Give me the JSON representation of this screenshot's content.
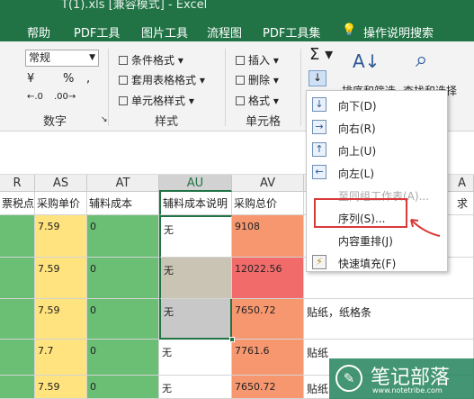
{
  "app": {
    "title": "T(1).xls [兼容模式] - Excel",
    "accent": "#217346"
  },
  "menubar": {
    "items": [
      "帮助",
      "PDF工具",
      "图片工具",
      "流程图",
      "PDF工具集",
      "操作说明搜索"
    ]
  },
  "ribbon": {
    "number_format": "常规",
    "currency_symbol": "¥",
    "percent_symbol": "%",
    "comma_symbol": ",",
    "styles_items": [
      "条件格式",
      "套用表格格式",
      "单元格样式"
    ],
    "cells_items": [
      "插入",
      "删除",
      "格式"
    ],
    "sort_filter": "排序和筛选",
    "find_select": "查找和选择",
    "groups": [
      "数字",
      "样式",
      "单元格"
    ]
  },
  "columns": [
    {
      "letter": "R",
      "header": "票税点"
    },
    {
      "letter": "AS",
      "header": "采购单价"
    },
    {
      "letter": "AT",
      "header": "辅料成本"
    },
    {
      "letter": "AU",
      "header": "辅料成本说明"
    },
    {
      "letter": "AV",
      "header": "采购总价"
    },
    {
      "letter": "A",
      "header": "求"
    }
  ],
  "rows": [
    {
      "as": "7.59",
      "at": "0",
      "au": "无",
      "av": "9108",
      "aw": ""
    },
    {
      "as": "7.59",
      "at": "0",
      "au": "无",
      "av": "12022.56",
      "aw": ""
    },
    {
      "as": "7.59",
      "at": "0",
      "au": "无",
      "av": "7650.72",
      "aw": "贴纸，纸格条"
    },
    {
      "as": "7.7",
      "at": "0",
      "au": "无",
      "av": "7761.6",
      "aw": "贴纸"
    },
    {
      "as": "7.59",
      "at": "0",
      "au": "无",
      "av": "7650.72",
      "aw": "贴纸"
    }
  ],
  "fill_menu": {
    "items": [
      {
        "label": "向下(D)",
        "icon": "down-arrow",
        "disabled": false
      },
      {
        "label": "向右(R)",
        "icon": "right-arrow",
        "disabled": false
      },
      {
        "label": "向上(U)",
        "icon": "up-arrow",
        "disabled": false
      },
      {
        "label": "向左(L)",
        "icon": "left-arrow",
        "disabled": false
      },
      {
        "label": "至同组工作表(A)...",
        "icon": "",
        "disabled": true
      },
      {
        "label": "序列(S)...",
        "icon": "",
        "disabled": false
      },
      {
        "label": "内容重排(J)",
        "icon": "",
        "disabled": false
      },
      {
        "label": "快速填充(F)",
        "icon": "flash-fill",
        "disabled": false
      }
    ]
  },
  "watermark": {
    "text": "笔记部落",
    "sub": "www.notetribe.com"
  }
}
